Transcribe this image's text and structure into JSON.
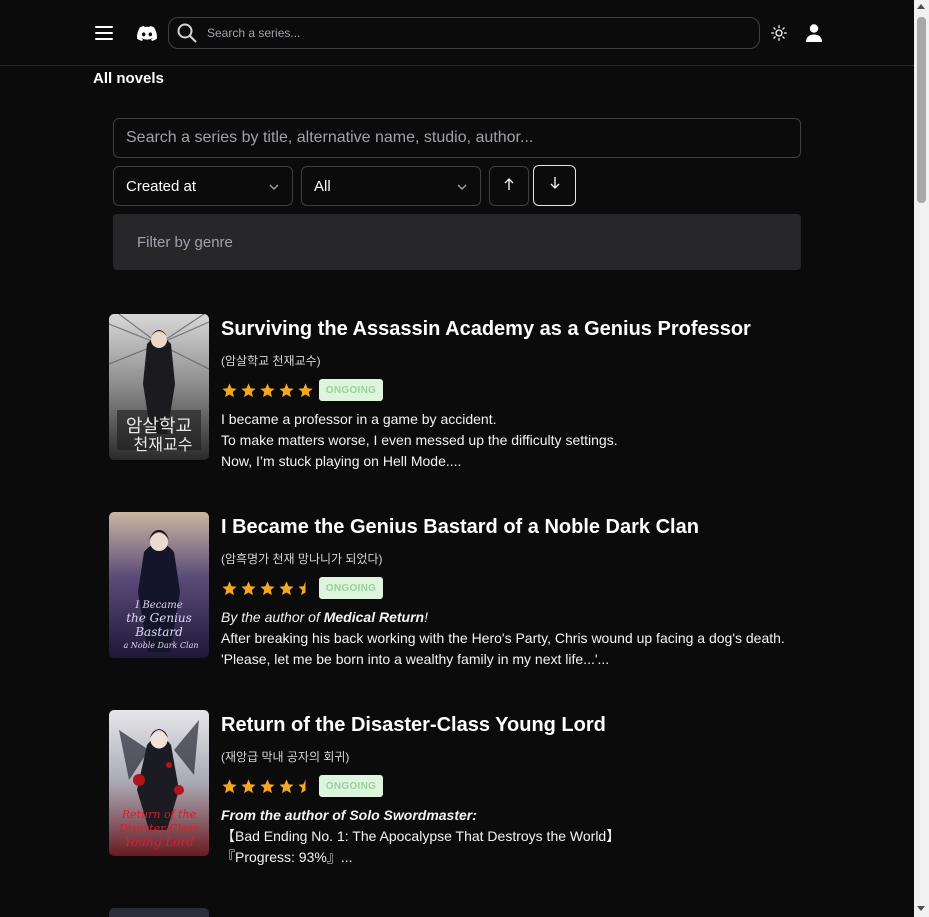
{
  "header": {
    "search_placeholder": "Search a series...",
    "icons": [
      "menu-icon",
      "discord-icon",
      "search-icon",
      "sun-icon",
      "user-icon"
    ]
  },
  "page": {
    "title": "All novels",
    "search_placeholder": "Search a series by title, alternative name, studio, author...",
    "sort_select": "Created at",
    "status_select": "All",
    "genre_filter_placeholder": "Filter by genre"
  },
  "colors": {
    "background": "#0b0b0c",
    "star": "#f5a623",
    "badge_bg": "#dcf5dc",
    "badge_text": "#9ccf9e"
  },
  "novels": [
    {
      "title": "Surviving the Assassin Academy as a Genius Professor",
      "alt_title": "(암살학교 천재교수)",
      "rating": 5,
      "status": "ONGOING",
      "synopsis": [
        "I became a professor in a game by accident.",
        "To make matters worse, I even messed up the difficulty settings.",
        "Now, I’m stuck playing on Hell Mode...."
      ]
    },
    {
      "title": "I Became the Genius Bastard of a Noble Dark Clan",
      "alt_title": "(암흑명가 천재 망나니가 되었다)",
      "rating": 4.5,
      "status": "ONGOING",
      "synopsis_intro": "By the author of ",
      "synopsis_intro_bold": "Medical Return",
      "synopsis_intro_end": "!",
      "synopsis": [
        "After breaking his back working with the Hero's Party, Chris wound up facing a dog's death.",
        "'Please, let me be born into a wealthy family in my next life...'..."
      ]
    },
    {
      "title": "Return of the Disaster-Class Young Lord",
      "alt_title": "(재앙급 막내 공자의 회귀)",
      "rating": 4.5,
      "status": "ONGOING",
      "synopsis_intro": "From the author of Solo Swordmaster:",
      "synopsis": [
        "【Bad Ending No. 1: The Apocalypse That Destroys the World】",
        "『Progress: 93%』..."
      ]
    }
  ]
}
